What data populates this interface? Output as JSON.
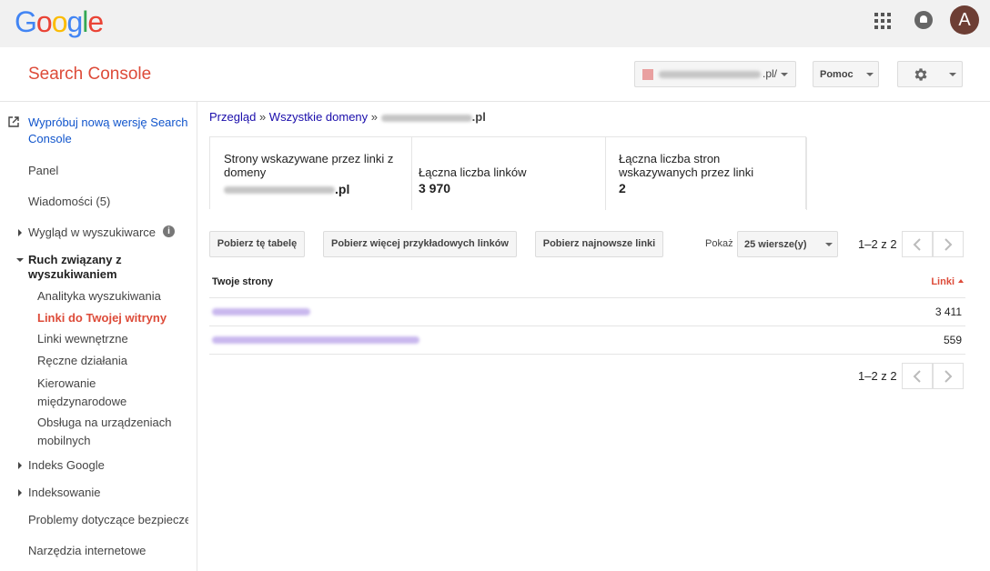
{
  "app": {
    "google_logo": [
      {
        "ch": "G",
        "color": "#4285f4"
      },
      {
        "ch": "o",
        "color": "#ea4335"
      },
      {
        "ch": "o",
        "color": "#fbbc05"
      },
      {
        "ch": "g",
        "color": "#4285f4"
      },
      {
        "ch": "l",
        "color": "#34a853"
      },
      {
        "ch": "e",
        "color": "#ea4335"
      }
    ],
    "avatar_letter": "A",
    "title": "Search Console",
    "title_color": "#dd4b39"
  },
  "header": {
    "site_suffix": ".pl/",
    "help_label": "Pomoc"
  },
  "sidebar": {
    "try_new": "Wypróbuj nową wersję Search Console",
    "items": [
      {
        "label": "Panel"
      },
      {
        "label": "Wiadomości (5)"
      },
      {
        "label": "Wygląd w wyszukiwarce"
      },
      {
        "label": "Ruch związany z wyszukiwaniem"
      },
      {
        "label": "Analityka wyszukiwania"
      },
      {
        "label": "Linki do Twojej witryny"
      },
      {
        "label": "Linki wewnętrzne"
      },
      {
        "label": "Ręczne działania"
      },
      {
        "label": "Kierowanie międzynarodowe"
      },
      {
        "label": "Obsługa na urządzeniach mobilnych"
      },
      {
        "label": "Indeks Google"
      },
      {
        "label": "Indeksowanie"
      },
      {
        "label": "Problemy dotyczące bezpieczeństwa"
      },
      {
        "label": "Narzędzia internetowe"
      }
    ],
    "info_glyph": "i"
  },
  "breadcrumb": {
    "overview": "Przegląd",
    "sep": "»",
    "all_domains": "Wszystkie domeny",
    "domain_suffix": ".pl"
  },
  "summary": {
    "linked_pages_caption": "Strony wskazywane przez linki z domeny",
    "linked_pages_suffix": ".pl",
    "total_links_caption": "Łączna liczba linków",
    "total_links_value": "3 970",
    "total_pages_caption": "Łączna liczba stron wskazywanych przez linki",
    "total_pages_value": "2"
  },
  "toolbar": {
    "download_table": "Pobierz tę tabelę",
    "download_more": "Pobierz więcej przykładowych linków",
    "download_latest": "Pobierz najnowsze linki",
    "show_label": "Pokaż",
    "rows_selected": "25 wiersze(y)",
    "pager_text": "1–2 z 2"
  },
  "table": {
    "col_pages": "Twoje strony",
    "col_links": "Linki",
    "rows": [
      {
        "links": "3 411"
      },
      {
        "links": "559"
      }
    ]
  }
}
